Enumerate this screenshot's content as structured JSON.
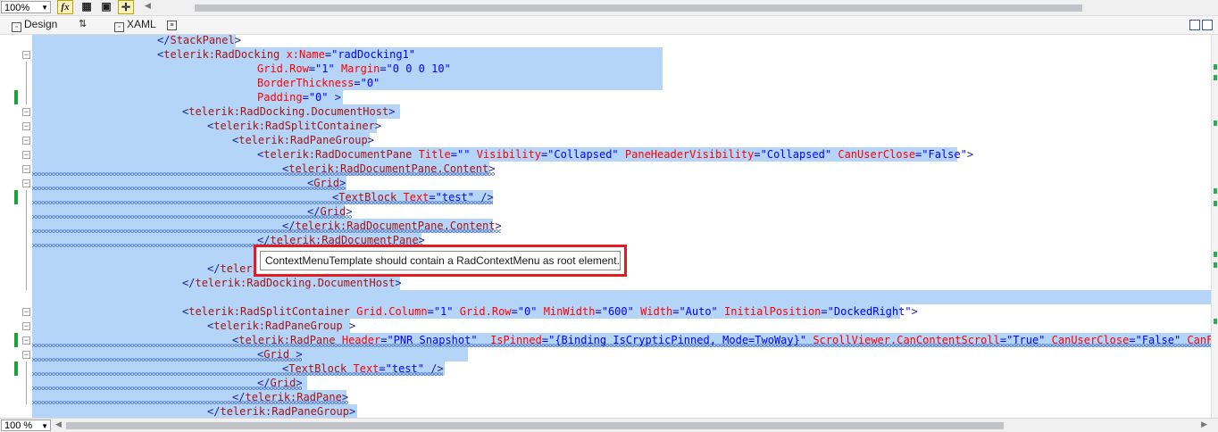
{
  "toolbar": {
    "zoom_value": "100%",
    "fx_label": "fx",
    "icons": [
      "fx-icon",
      "grid-icon",
      "snap-icon",
      "crosshair-icon"
    ]
  },
  "tabs": {
    "design_label": "Design",
    "swap_label": "⇅",
    "xaml_label": "XAML"
  },
  "editor": {
    "lines": [
      {
        "code": "</StackPanel>",
        "fold": "",
        "change": false,
        "squiggle": false
      },
      {
        "code": "<telerik:RadDocking x:Name=\"radDocking1\"",
        "fold": "−",
        "change": false,
        "squiggle": false
      },
      {
        "code": "Grid.Row=\"1\" Margin=\"0 0 0 10\"",
        "fold": "",
        "change": false,
        "squiggle": false
      },
      {
        "code": "BorderThickness=\"0\"",
        "fold": "",
        "change": false,
        "squiggle": false
      },
      {
        "code": "Padding=\"0\" >",
        "fold": "",
        "change": true,
        "squiggle": false
      },
      {
        "code": "<telerik:RadDocking.DocumentHost>",
        "fold": "−",
        "change": false,
        "squiggle": false
      },
      {
        "code": "<telerik:RadSplitContainer>",
        "fold": "−",
        "change": false,
        "squiggle": false
      },
      {
        "code": "<telerik:RadPaneGroup>",
        "fold": "−",
        "change": false,
        "squiggle": false
      },
      {
        "code": "<telerik:RadDocumentPane Title=\"\" Visibility=\"Collapsed\" PaneHeaderVisibility=\"Collapsed\" CanUserClose=\"False\">",
        "fold": "−",
        "change": false,
        "squiggle": false
      },
      {
        "code": "<telerik:RadDocumentPane.Content>",
        "fold": "−",
        "change": false,
        "squiggle": true
      },
      {
        "code": "<Grid>",
        "fold": "−",
        "change": false,
        "squiggle": true
      },
      {
        "code": "<TextBlock Text=\"test\" />",
        "fold": "",
        "change": true,
        "squiggle": true
      },
      {
        "code": "</Grid>",
        "fold": "",
        "change": false,
        "squiggle": true
      },
      {
        "code": "</telerik:RadDocumentPane.Content>",
        "fold": "",
        "change": false,
        "squiggle": true
      },
      {
        "code": "</telerik:RadDocumentPane>",
        "fold": "",
        "change": false,
        "squiggle": true
      },
      {
        "code": "</te",
        "fold": "",
        "change": false,
        "squiggle": false
      },
      {
        "code": "</telerik",
        "fold": "",
        "change": false,
        "squiggle": false
      },
      {
        "code": "</telerik:RadDocking.DocumentHost>",
        "fold": "",
        "change": false,
        "squiggle": false
      },
      {
        "code": "",
        "fold": "",
        "change": false,
        "squiggle": false
      },
      {
        "code": "<telerik:RadSplitContainer Grid.Column=\"1\" Grid.Row=\"0\" MinWidth=\"600\" Width=\"Auto\" InitialPosition=\"DockedRight\">",
        "fold": "−",
        "change": false,
        "squiggle": false
      },
      {
        "code": "<telerik:RadPaneGroup >",
        "fold": "−",
        "change": false,
        "squiggle": false
      },
      {
        "code": "<telerik:RadPane Header=\"PNR Snapshot\"  IsPinned=\"{Binding IsCrypticPinned, Mode=TwoWay}\" ScrollViewer.CanContentScroll=\"True\" CanUserClose=\"False\" CanFloat=",
        "fold": "−",
        "change": true,
        "squiggle": true
      },
      {
        "code": "<Grid >",
        "fold": "−",
        "change": false,
        "squiggle": true
      },
      {
        "code": "<TextBlock Text=\"test\" />",
        "fold": "",
        "change": true,
        "squiggle": true
      },
      {
        "code": "</Grid>",
        "fold": "",
        "change": false,
        "squiggle": true
      },
      {
        "code": "</telerik:RadPane>",
        "fold": "",
        "change": false,
        "squiggle": true
      },
      {
        "code": "</telerik:RadPaneGroup>",
        "fold": "",
        "change": false,
        "squiggle": false
      }
    ]
  },
  "tooltip": {
    "text": "ContextMenuTemplate should contain a RadContextMenu as root element."
  },
  "bottom": {
    "zoom_value": "100 %"
  },
  "colors": {
    "selection": "#b4d4f8",
    "element": "#a31515",
    "attribute": "#ff0000",
    "value": "#0000ff",
    "bracket": "#1e1e8c",
    "change_marker": "#1ea135",
    "tooltip_border": "#e31b23"
  }
}
